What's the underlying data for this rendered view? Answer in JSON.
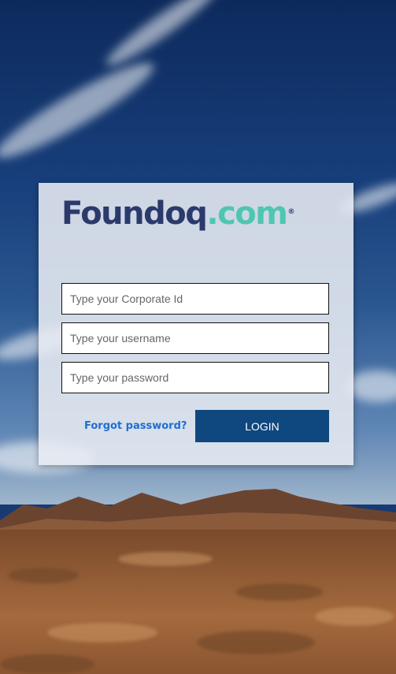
{
  "brand": {
    "logo_part1": "Foundoq",
    "logo_part2": ".com",
    "registered_mark": "®",
    "colors": {
      "dark": "#2b3a6b",
      "teal": "#4fc6b0"
    }
  },
  "form": {
    "corporate_id": {
      "value": "",
      "placeholder": "Type your Corporate Id"
    },
    "username": {
      "value": "",
      "placeholder": "Type your username"
    },
    "password": {
      "value": "",
      "placeholder": "Type your password"
    },
    "forgot_label": "Forgot password?",
    "login_label": "LOGIN"
  },
  "colors": {
    "button": "#0f477f",
    "link": "#1f6fd0"
  }
}
